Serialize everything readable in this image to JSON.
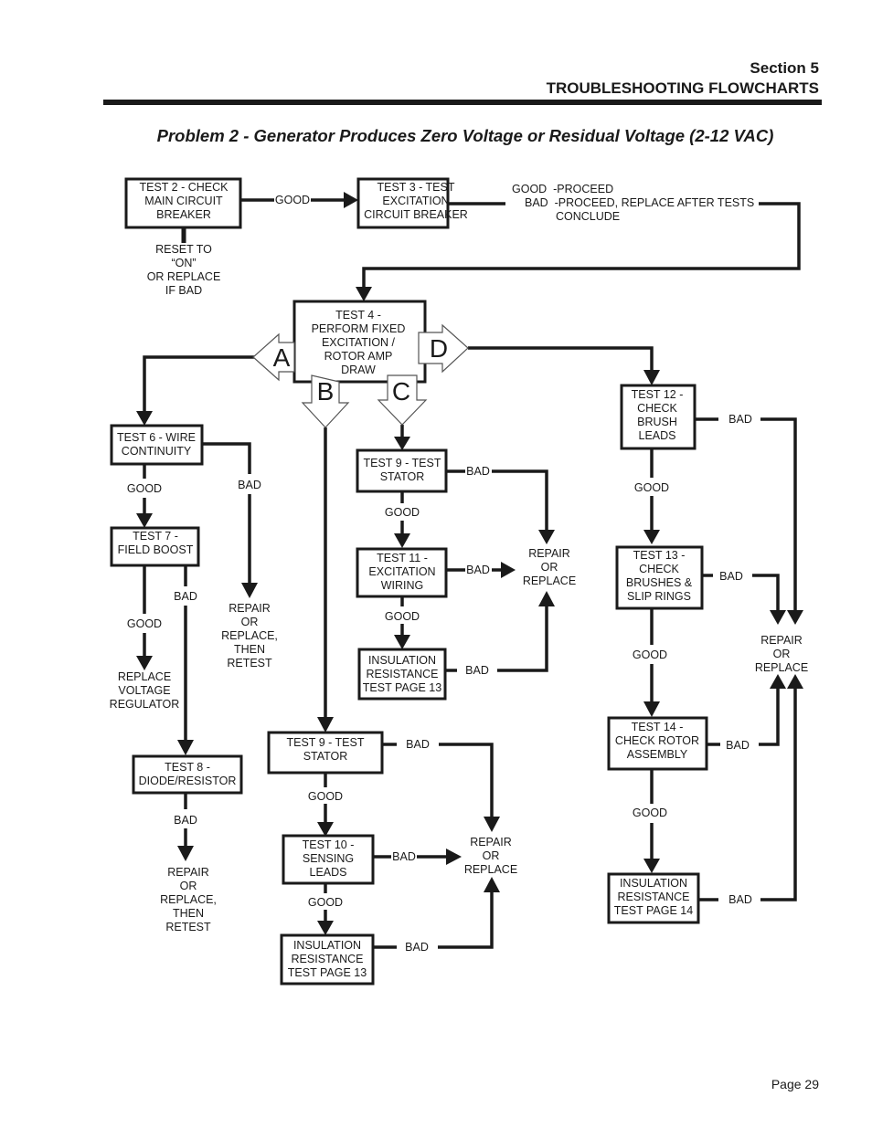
{
  "header": {
    "section": "Section 5",
    "title": "TROUBLESHOOTING FLOWCHARTS"
  },
  "problem_title": "Problem 2 -  Generator Produces Zero Voltage or Residual Voltage (2-12 VAC)",
  "page_label": "Page 29",
  "connectors": {
    "a": "A",
    "b": "B",
    "c": "C",
    "d": "D"
  },
  "boxes": {
    "test2": [
      "TEST 2 - CHECK",
      "MAIN CIRCUIT",
      "BREAKER"
    ],
    "test3": [
      "TEST 3 - TEST",
      "EXCITATION",
      "CIRCUIT BREAKER"
    ],
    "test4": [
      "TEST 4 -",
      "PERFORM FIXED",
      "EXCITATION /",
      "ROTOR AMP",
      "DRAW"
    ],
    "test6": [
      "TEST 6 - WIRE",
      "CONTINUITY"
    ],
    "test7": [
      "TEST 7 -",
      "FIELD BOOST"
    ],
    "test8": [
      "TEST 8 -",
      "DIODE/RESISTOR"
    ],
    "test9c": [
      "TEST 9 - TEST",
      "STATOR"
    ],
    "test11": [
      "TEST 11 -",
      "EXCITATION",
      "WIRING"
    ],
    "ins13c": [
      "INSULATION",
      "RESISTANCE",
      "TEST PAGE 13"
    ],
    "test9b": [
      "TEST 9 - TEST",
      "STATOR"
    ],
    "test10": [
      "TEST 10 -",
      "SENSING",
      "LEADS"
    ],
    "ins13b": [
      "INSULATION",
      "RESISTANCE",
      "TEST PAGE 13"
    ],
    "test12": [
      "TEST 12 -",
      "CHECK",
      "BRUSH",
      "LEADS"
    ],
    "test13": [
      "TEST 13 -",
      "CHECK",
      "BRUSHES &",
      "SLIP RINGS"
    ],
    "test14": [
      "TEST 14 -",
      "CHECK ROTOR",
      "ASSEMBLY"
    ],
    "ins14": [
      "INSULATION",
      "RESISTANCE",
      "TEST PAGE 14"
    ]
  },
  "notes": {
    "reset": [
      "RESET TO",
      "“ON”",
      "OR REPLACE",
      "IF BAD"
    ],
    "test3_good": "GOOD  -PROCEED",
    "test3_bad": "BAD  -PROCEED, REPLACE AFTER TESTS",
    "test3_bad2": "CONCLUDE",
    "repair_retest": [
      "REPAIR",
      "OR",
      "REPLACE,",
      "THEN",
      "RETEST"
    ],
    "replace_vr": [
      "REPLACE",
      "VOLTAGE",
      "REGULATOR"
    ],
    "repair": [
      "REPAIR",
      "OR",
      "REPLACE"
    ]
  },
  "labels": {
    "good": "GOOD",
    "bad": "BAD"
  }
}
